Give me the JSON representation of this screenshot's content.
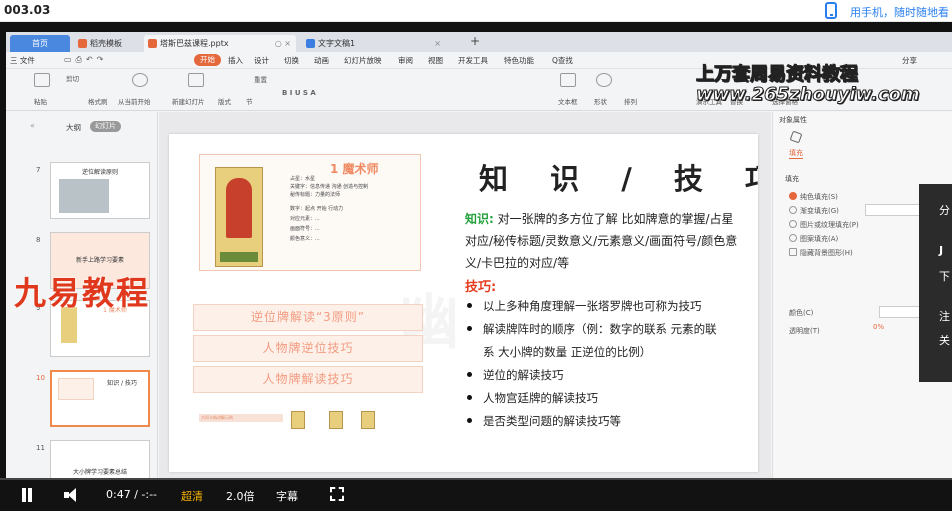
{
  "page": {
    "title": "003.03"
  },
  "promo": {
    "text": "用手机，随时随地看"
  },
  "watermarks": {
    "line1": "上万套周易资料教程",
    "line2": "www.265zhouyiw.com",
    "side": "九易教程"
  },
  "app": {
    "tabs": [
      {
        "label": "首页"
      },
      {
        "label": "稻壳模板"
      },
      {
        "label": "塔斯巴兹课程.pptx"
      },
      {
        "label": "文字文稿1"
      },
      {
        "label": "+"
      }
    ],
    "menu": [
      "三 文件",
      "开始",
      "插入",
      "设计",
      "切换",
      "动画",
      "幻灯片放映",
      "审阅",
      "视图",
      "开发工具",
      "特色功能",
      "Q查找",
      "分享"
    ],
    "ribbon": [
      "剪切",
      "粘贴",
      "格式刷",
      "从当前开始",
      "新建幻灯片",
      "版式",
      "节",
      "重置",
      "文本框",
      "形状",
      "排列",
      "演示工具",
      "替换",
      "选择窗格"
    ]
  },
  "leftpane": {
    "outline_tab": "大纲",
    "slides_tab": "幻灯片",
    "thumbs": [
      {
        "num": "7",
        "title": "逆位解读原则"
      },
      {
        "num": "8",
        "title": "新手上路学习要素"
      },
      {
        "num": "9",
        "title": "1 魔术师"
      },
      {
        "num": "10",
        "title": "知识 / 技巧"
      },
      {
        "num": "11",
        "title": "大小牌学习要素总结"
      }
    ]
  },
  "slide": {
    "card": {
      "title": "1 魔术师",
      "name": "THE MAGICIAN",
      "lines": [
        "占星：水星",
        "关键字：信息传递 沟通 创造与控制",
        "秘传标题：力量的法师",
        "数字：起点 开始 行动力",
        "对应元素：...",
        "画面符号：...",
        "颜色意义：..."
      ]
    },
    "banners": [
      "逆位牌解读“3原则”",
      "人物牌逆位技巧",
      "人物牌解读技巧"
    ],
    "footer": "大阿卡纳讲解示例",
    "title": "知 识 / 技 巧",
    "knowledge_label": "知识:",
    "knowledge_text": "对一张牌的多方位了解 比如牌意的掌握/占星对应/秘传标题/灵数意义/元素意义/画面符号/颜色意义/卡巴拉的对应/等",
    "skills_label": "技巧:",
    "bullets": [
      "以上多种角度理解一张塔罗牌也可称为技巧",
      "解读牌阵时的顺序（例：数字的联系 元素的联",
      "逆位的解读技巧",
      "人物宫廷牌的解读技巧",
      "是否类型问题的解读技巧等"
    ],
    "bullet2_cont": "系 大小牌的数量 正逆位的比例）"
  },
  "rightpane": {
    "title": "对象属性",
    "tab": "填充",
    "section": "填充",
    "options": [
      "纯色填充(S)",
      "渐变填充(G)",
      "图片或纹理填充(P)",
      "图案填充(A)",
      "隐藏背景图形(H)"
    ],
    "color_label": "颜色(C)",
    "transparency_label": "透明度(T)",
    "transparency_value": "0%"
  },
  "overlay": {
    "lines": [
      "分",
      "J",
      "下",
      "注",
      "关"
    ]
  },
  "player": {
    "time": "0:47 / -:--",
    "quality": "超清",
    "speed": "2.0倍",
    "subtitle": "字幕"
  }
}
